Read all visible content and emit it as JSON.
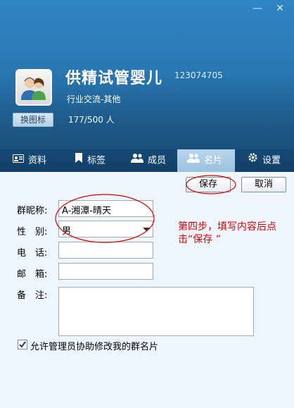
{
  "window": {
    "min_glyph": "—",
    "close_glyph": "✕"
  },
  "header": {
    "group_name": "供精试管婴儿",
    "group_id": "123074705",
    "category": "行业交流-其他",
    "change_icon_label": "换图标",
    "member_count": "177/500 人"
  },
  "tabs": [
    {
      "label": "资料",
      "icon": "profile-card-icon"
    },
    {
      "label": "标签",
      "icon": "bookmark-icon"
    },
    {
      "label": "成员",
      "icon": "members-icon"
    },
    {
      "label": "名片",
      "icon": "namecard-icon",
      "active": true
    },
    {
      "label": "设置",
      "icon": "gear-icon"
    }
  ],
  "actions": {
    "save_label": "保存",
    "cancel_label": "取消"
  },
  "form": {
    "nickname_label": "群昵称:",
    "nickname_value": "A-湘潭-晴天",
    "gender_label": "性　别:",
    "gender_value": "男",
    "phone_label": "电　话:",
    "phone_value": "",
    "email_label": "邮　箱:",
    "email_value": "",
    "note_label": "备　注:",
    "note_value": "",
    "allow_admin_label": "允许管理员协助修改我的群名片",
    "allow_admin_checked": true
  },
  "annotation": {
    "line1": "第四步，填写内容后点",
    "line2": "击“保存 ”",
    "color": "#e00000"
  },
  "colors": {
    "header_blue": "#2a78b4",
    "tabbar_dark": "#123f66",
    "tab_active": "#99c1df",
    "content_bg": "#eef5fc"
  }
}
